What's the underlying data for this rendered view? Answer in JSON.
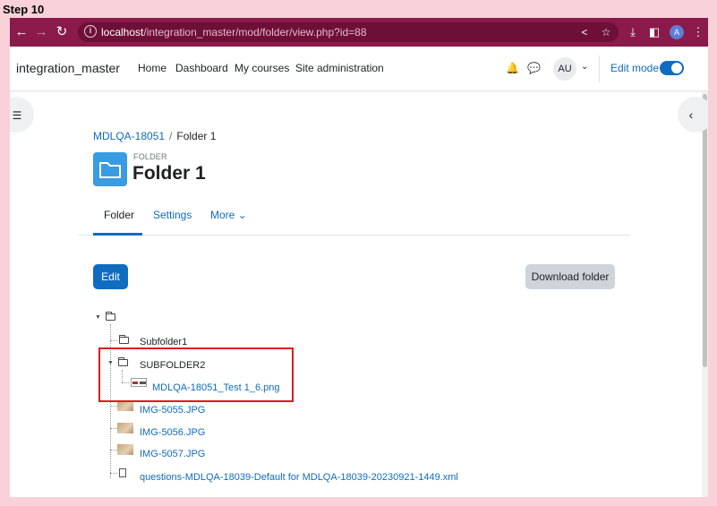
{
  "step_label": "Step 10",
  "browser": {
    "url_host": "localhost",
    "url_path": "/integration_master/mod/folder/view.php?id=88",
    "profile_initial": "A"
  },
  "navbar": {
    "site_name": "integration_master",
    "links": [
      "Home",
      "Dashboard",
      "My courses",
      "Site administration"
    ],
    "user_initials": "AU",
    "edit_mode_label": "Edit mode",
    "edit_mode_on": true
  },
  "breadcrumb": {
    "course": "MDLQA-18051",
    "separator": "/",
    "current": "Folder 1"
  },
  "activity": {
    "type_label": "FOLDER",
    "title": "Folder 1",
    "icon_color": "#399be2"
  },
  "tabs": [
    {
      "label": "Folder",
      "active": true
    },
    {
      "label": "Settings",
      "active": false
    },
    {
      "label": "More ⌄",
      "active": false
    }
  ],
  "buttons": {
    "edit": "Edit",
    "download": "Download folder"
  },
  "tree": {
    "subfolder1": "Subfolder1",
    "subfolder2": "SUBFOLDER2",
    "subfolder2_file": "MDLQA-18051_Test 1_6.png",
    "files": [
      "IMG-5055.JPG",
      "IMG-5056.JPG",
      "IMG-5057.JPG"
    ],
    "xml_file": "questions-MDLQA-18039-Default for MDLQA-18039-20230921-1449.xml"
  },
  "colors": {
    "brand_chrome": "#8a1a4a",
    "primary": "#0f6cbf",
    "highlight": "#e0191f"
  }
}
